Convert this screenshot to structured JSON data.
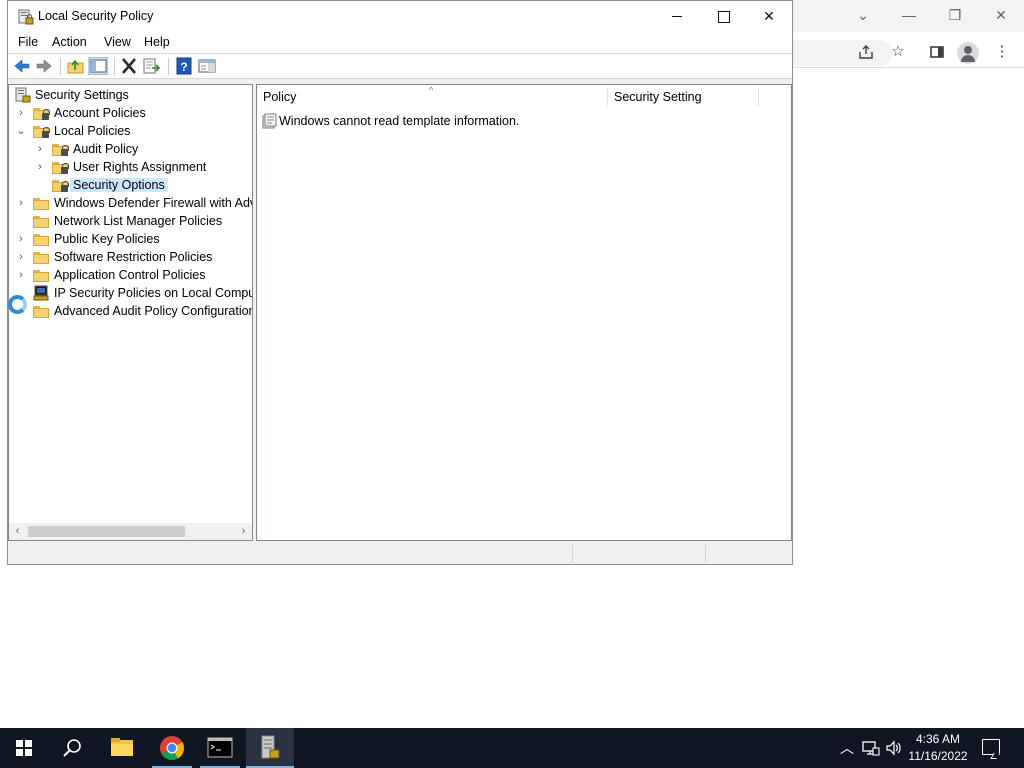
{
  "window": {
    "title": "Local Security Policy",
    "controls": {
      "minimize": "—",
      "maximize": "☐",
      "close": "✕"
    }
  },
  "menu": [
    "File",
    "Action",
    "View",
    "Help"
  ],
  "toolbar": [
    "back-icon",
    "forward-icon",
    "up-folder-icon",
    "show-hide-tree-icon",
    "delete-icon",
    "export-list-icon",
    "help-icon",
    "properties-pane-icon"
  ],
  "tree": {
    "items": [
      {
        "label": "Security Settings",
        "level": 0,
        "expand": "",
        "icon": "security-settings-icon"
      },
      {
        "label": "Account Policies",
        "level": 1,
        "expand": "›",
        "icon": "folder-lock-icon"
      },
      {
        "label": "Local Policies",
        "level": 1,
        "expand": "⌄",
        "icon": "folder-lock-icon"
      },
      {
        "label": "Audit Policy",
        "level": 2,
        "expand": "›",
        "icon": "folder-lock-icon"
      },
      {
        "label": "User Rights Assignment",
        "level": 2,
        "expand": "›",
        "icon": "folder-lock-icon"
      },
      {
        "label": "Security Options",
        "level": 2,
        "expand": "",
        "icon": "folder-lock-icon",
        "selected": true
      },
      {
        "label": "Windows Defender Firewall with Adva",
        "level": 1,
        "expand": "›",
        "icon": "folder-icon"
      },
      {
        "label": "Network List Manager Policies",
        "level": 1,
        "expand": "",
        "icon": "folder-icon"
      },
      {
        "label": "Public Key Policies",
        "level": 1,
        "expand": "›",
        "icon": "folder-icon"
      },
      {
        "label": "Software Restriction Policies",
        "level": 1,
        "expand": "›",
        "icon": "folder-icon"
      },
      {
        "label": "Application Control Policies",
        "level": 1,
        "expand": "›",
        "icon": "folder-icon"
      },
      {
        "label": "IP Security Policies on Local Compute",
        "level": 1,
        "expand": "",
        "icon": "ip-security-icon"
      },
      {
        "label": "Advanced Audit Policy Configuration",
        "level": 1,
        "expand": "›",
        "icon": "folder-icon"
      }
    ]
  },
  "result": {
    "columns": [
      "Policy",
      "Security Setting"
    ],
    "sort_indicator": "^",
    "rows": [
      {
        "text": "Windows cannot read template information.",
        "icon": "template-icon"
      }
    ]
  },
  "scroll": {
    "left": "‹",
    "right": "›"
  },
  "taskbar": {
    "apps": [
      "start-icon",
      "search-icon",
      "file-explorer-icon",
      "chrome-icon",
      "terminal-icon",
      "local-security-policy-icon"
    ],
    "tray": {
      "chevron": "︿",
      "network": "network-icon",
      "volume": "volume-icon"
    },
    "time": "4:36 AM",
    "date": "11/16/2022"
  },
  "browser": {
    "tab_controls": [
      "⌄",
      "—",
      "❐",
      "✕"
    ],
    "tools": [
      "share-icon",
      "bookmark-star-icon",
      "side-panel-icon",
      "profile-avatar",
      "more-menu-icon"
    ]
  }
}
